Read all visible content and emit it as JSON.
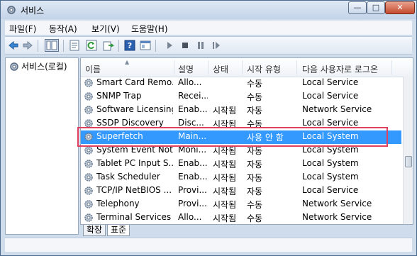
{
  "window": {
    "title": "서비스",
    "controls": {
      "minimize": "—",
      "maximize": "□",
      "close": "✕"
    }
  },
  "menu": [
    {
      "label": "파일(F)"
    },
    {
      "label": "동작(A)"
    },
    {
      "label": "보기(V)"
    },
    {
      "label": "도움말(H)"
    }
  ],
  "toolbar": {
    "buttons": [
      "back-icon",
      "forward-icon",
      "show-tree-icon",
      "properties-icon",
      "refresh-icon",
      "export-icon",
      "help-icon",
      "console-icon",
      "start-icon",
      "stop-icon",
      "pause-icon",
      "restart-icon"
    ]
  },
  "tree": {
    "root_label": "서비스(로컬)"
  },
  "table": {
    "columns": [
      "이름",
      "설명",
      "상태",
      "시작 유형",
      "다음 사용자로 로그온"
    ],
    "rows": [
      {
        "name": "Smart Card Remo...",
        "desc": "Allo...",
        "status": "",
        "startup": "수동",
        "logon": "Local Service"
      },
      {
        "name": "SNMP Trap",
        "desc": "Recei...",
        "status": "",
        "startup": "수동",
        "logon": "Local Service"
      },
      {
        "name": "Software Licensing",
        "desc": "Enab...",
        "status": "시작됨",
        "startup": "자동",
        "logon": "Network Service"
      },
      {
        "name": "SSDP Discovery",
        "desc": "Disc...",
        "status": "시작됨",
        "startup": "수동",
        "logon": "Local Service"
      },
      {
        "name": "Superfetch",
        "desc": "Main...",
        "status": "",
        "startup": "사용 안 함",
        "logon": "Local System",
        "selected": true
      },
      {
        "name": "System Event Not...",
        "desc": "Moni...",
        "status": "시작됨",
        "startup": "자동",
        "logon": "Local System"
      },
      {
        "name": "Tablet PC Input S...",
        "desc": "Enab...",
        "status": "시작됨",
        "startup": "자동",
        "logon": "Local System"
      },
      {
        "name": "Task Scheduler",
        "desc": "Enab...",
        "status": "시작됨",
        "startup": "자동",
        "logon": "Local System"
      },
      {
        "name": "TCP/IP NetBIOS ...",
        "desc": "Provi...",
        "status": "시작됨",
        "startup": "자동",
        "logon": "Local Service"
      },
      {
        "name": "Telephony",
        "desc": "Provi...",
        "status": "시작됨",
        "startup": "수동",
        "logon": "Network Service"
      },
      {
        "name": "Terminal Services",
        "desc": "Allo...",
        "status": "시작됨",
        "startup": "수동",
        "logon": "Network Service"
      }
    ]
  },
  "tabs": [
    {
      "label": "확장"
    },
    {
      "label": "표준"
    }
  ],
  "colors": {
    "selection": "#3399ff",
    "highlight_border": "#e0405e"
  }
}
